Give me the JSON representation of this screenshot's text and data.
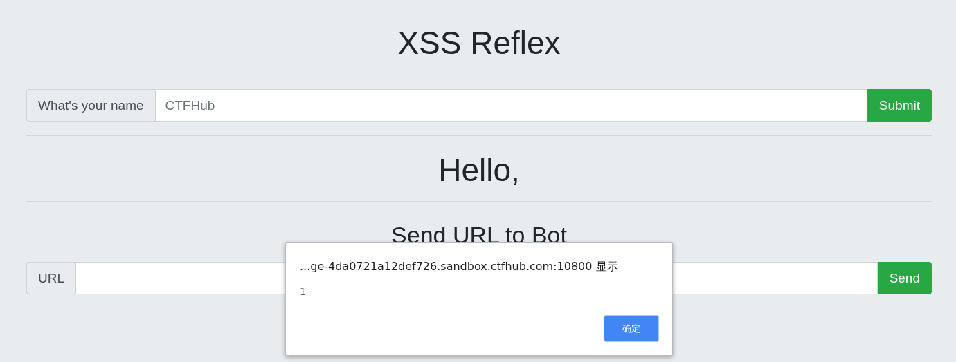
{
  "title": "XSS Reflex",
  "name_form": {
    "label": "What's your name",
    "placeholder": "CTFHub",
    "button": "Submit"
  },
  "greeting": "Hello,",
  "bot_section": {
    "heading": "Send URL to Bot",
    "label": "URL",
    "button": "Send"
  },
  "dialog": {
    "origin": "...ge-4da0721a12def726.sandbox.ctfhub.com:10800 显示",
    "message": "1",
    "button": "确定"
  }
}
